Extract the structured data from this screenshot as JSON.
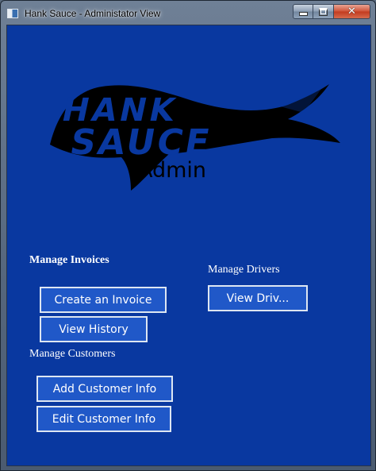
{
  "window": {
    "title": "Hank Sauce - Administator View"
  },
  "logo": {
    "subtitle": "Admin",
    "line1": "HANK",
    "line2": "SAUCE"
  },
  "sections": {
    "invoices_label": "Manage Invoices",
    "drivers_label": "Manage Drivers",
    "customers_label": "Manage Customers"
  },
  "buttons": {
    "create_invoice": "Create an Invoice",
    "view_history": "View History",
    "view_drivers": "View Driv...",
    "add_customer": "Add Customer Info",
    "edit_customer": "Edit Customer Info"
  },
  "colors": {
    "background": "#0938a0",
    "button": "#2058c8",
    "button_border": "#dde6f2"
  }
}
